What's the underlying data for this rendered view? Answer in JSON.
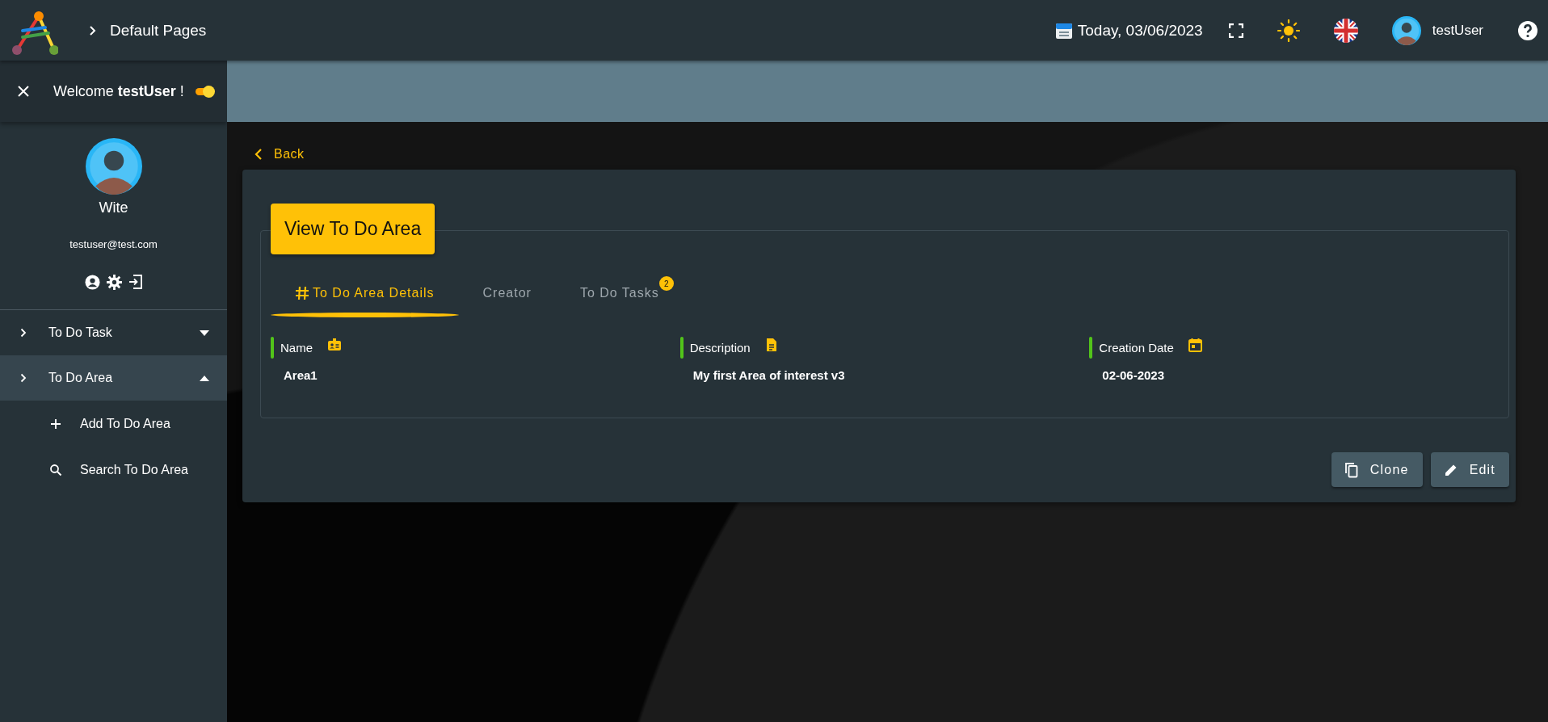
{
  "topbar": {
    "breadcrumb": "Default Pages",
    "date": "Today, 03/06/2023",
    "username": "testUser"
  },
  "sidebar": {
    "welcome": {
      "prefix": "Welcome",
      "user": "testUser",
      "suffix": "!",
      "toggle_on": true
    },
    "profile": {
      "name": "Wite",
      "email": "testuser@test.com"
    },
    "menu": [
      {
        "label": "To Do Task",
        "expanded": false,
        "selected": false
      },
      {
        "label": "To Do Area",
        "expanded": true,
        "selected": true,
        "children": [
          {
            "label": "Add To Do Area",
            "kind": "add"
          },
          {
            "label": "Search To Do Area",
            "kind": "search"
          }
        ]
      }
    ]
  },
  "back": "Back",
  "card": {
    "title": "View To Do Area",
    "tabs": [
      {
        "label": "To Do Area Details",
        "selected": true
      },
      {
        "label": "Creator",
        "selected": false
      },
      {
        "label": "To Do Tasks",
        "selected": false,
        "badge": "2"
      }
    ],
    "fields": [
      {
        "label": "Name",
        "value": "Area1",
        "kind": "name"
      },
      {
        "label": "Description",
        "value": "My first Area of interest v3",
        "kind": "description"
      },
      {
        "label": "Creation Date",
        "value": "02-06-2023",
        "kind": "date"
      }
    ],
    "buttons": [
      {
        "label": "Clone",
        "kind": "clone"
      },
      {
        "label": "Edit",
        "kind": "edit"
      }
    ]
  }
}
